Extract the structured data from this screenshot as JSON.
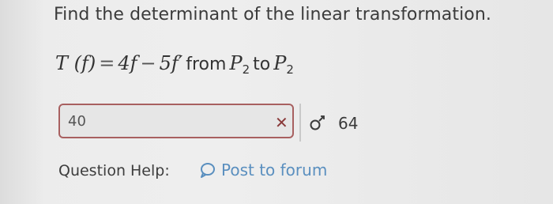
{
  "question": {
    "prompt": "Find the determinant of the linear transformation.",
    "formula": {
      "lhs": "T (f)",
      "equals": "=",
      "term1": "4f",
      "minus": "−",
      "term2": "5f′",
      "from_word": "from",
      "from_space": "P",
      "from_sub": "2",
      "to_word": "to",
      "to_space": "P",
      "to_sub": "2"
    }
  },
  "answer": {
    "value": "40",
    "status_icon": "x-icon",
    "status_color": "#8a3a3a",
    "border_color": "#a86060"
  },
  "attempts": {
    "icon": "resubmit-icon",
    "count": "64"
  },
  "help": {
    "label": "Question Help:",
    "forum_icon": "chat-bubble-icon",
    "forum_link": "Post to forum",
    "link_color": "#5a8fbf"
  }
}
